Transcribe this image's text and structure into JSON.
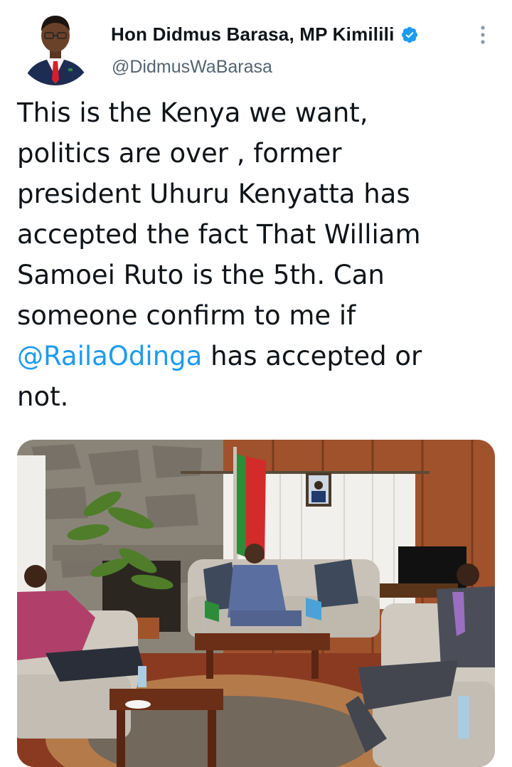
{
  "author": {
    "name": "Hon Didmus Barasa, MP Kimilili",
    "handle": "@DidmusWaBarasa",
    "verified": true,
    "avatar_icon": "profile-photo"
  },
  "more_icon": "more-vertical-icon",
  "tweet": {
    "lines": [
      "This is the Kenya we want,",
      "politics are over , former",
      "president Uhuru Kenyatta has",
      "accepted the fact That William",
      "Samoei Ruto is the 5th. Can",
      "someone confirm to me if"
    ],
    "mention": "@RailaOdinga",
    "after_mention": " has accepted or",
    "last_line": "not."
  },
  "colors": {
    "accent": "#1d9bf0",
    "text": "#0f1419",
    "secondary_text": "#536471"
  },
  "photo": {
    "description_icon": "meeting-photo"
  }
}
